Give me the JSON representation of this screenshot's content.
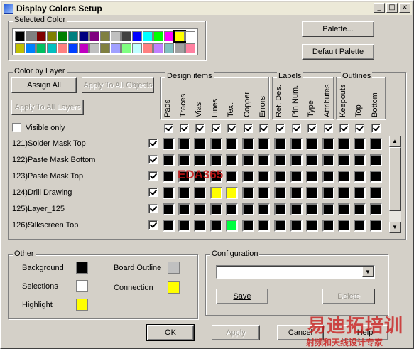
{
  "window": {
    "title": "Display Colors Setup"
  },
  "titlebar_buttons": {
    "minimize": "_",
    "maximize": "□",
    "close": "×"
  },
  "selected_color": {
    "label": "Selected Color",
    "row1": [
      "#000000",
      "#808080",
      "#800000",
      "#808000",
      "#008000",
      "#008080",
      "#000080",
      "#800080",
      "#808040",
      "#c0c0c0",
      "#404040",
      "#0000ff",
      "#00ffff",
      "#00ff00",
      "#ff00ff",
      "#ffff00",
      "#ffffff"
    ],
    "row2": [
      "#c0c000",
      "#0080ff",
      "#00c060",
      "#00c0c0",
      "#ff8080",
      "#0040ff",
      "#c000c0",
      "#c0c0c0",
      "#808040",
      "#a0a0ff",
      "#80ff80",
      "#c0ffff",
      "#ff8080",
      "#c080ff",
      "#80c0c0",
      "#a0a0a0",
      "#ff80a0"
    ],
    "selected_index": 15
  },
  "buttons": {
    "palette": "Palette...",
    "default_palette": "Default Palette",
    "assign_all": "Assign All",
    "apply_all_objects": "Apply To All Objects",
    "apply_all_layers": "Apply To All Layers",
    "save": "Save",
    "delete": "Delete",
    "ok": "OK",
    "apply": "Apply",
    "cancel": "Cancel",
    "help": "Help"
  },
  "color_by_layer": {
    "label": "Color by Layer",
    "visible_only": "Visible only",
    "groups": {
      "design": "Design items",
      "labels": "Labels",
      "outlines": "Outlines"
    },
    "columns": [
      "Pads",
      "Traces",
      "Vias",
      "Lines",
      "Text",
      "Copper",
      "Errors",
      "Ref. Des.",
      "Pin Num.",
      "Type",
      "Attributes",
      "Keepouts",
      "Top",
      "Bottom"
    ],
    "layers": [
      {
        "name": "121)Solder Mask Top",
        "colors": [
          "#000000",
          "#000000",
          "#000000",
          "#000000",
          "#000000",
          "#000000",
          "#000000",
          "#000000",
          "#000000",
          "#000000",
          "#000000",
          "#000000",
          "#000000",
          "#000000"
        ]
      },
      {
        "name": "122)Paste Mask Bottom",
        "colors": [
          "#000000",
          "#000000",
          "#000000",
          "#000000",
          "#000000",
          "#000000",
          "#000000",
          "#000000",
          "#000000",
          "#000000",
          "#000000",
          "#000000",
          "#000000",
          "#000000"
        ]
      },
      {
        "name": "123)Paste Mask Top",
        "colors": [
          "#000000",
          "#000000",
          "#000000",
          "#000000",
          "#000000",
          "#000000",
          "#000000",
          "#000000",
          "#000000",
          "#000000",
          "#000000",
          "#000000",
          "#000000",
          "#000000"
        ]
      },
      {
        "name": "124)Drill Drawing",
        "colors": [
          "#000000",
          "#000000",
          "#000000",
          "#ffff00",
          "#ffff00",
          "#000000",
          "#000000",
          "#000000",
          "#000000",
          "#000000",
          "#000000",
          "#000000",
          "#000000",
          "#000000"
        ]
      },
      {
        "name": "125)Layer_125",
        "colors": [
          "#000000",
          "#000000",
          "#000000",
          "#000000",
          "#000000",
          "#000000",
          "#000000",
          "#000000",
          "#000000",
          "#000000",
          "#000000",
          "#000000",
          "#000000",
          "#000000"
        ]
      },
      {
        "name": "126)Silkscreen Top",
        "colors": [
          "#000000",
          "#000000",
          "#000000",
          "#000000",
          "#00ff40",
          "#000000",
          "#000000",
          "#000000",
          "#000000",
          "#000000",
          "#000000",
          "#000000",
          "#000000",
          "#000000"
        ]
      }
    ]
  },
  "other": {
    "label": "Other",
    "background": {
      "label": "Background",
      "color": "#000000"
    },
    "selections": {
      "label": "Selections",
      "color": "#ffffff"
    },
    "highlight": {
      "label": "Highlight",
      "color": "#ffff00"
    },
    "board_outline": {
      "label": "Board Outline",
      "color": "#c0c0c0"
    },
    "connection": {
      "label": "Connection",
      "color": "#ffff00"
    }
  },
  "configuration": {
    "label": "Configuration",
    "value": ""
  },
  "watermarks": {
    "top": "EDA365",
    "bottom_main": "易迪拓培训",
    "bottom_sub": "射频和天线设计专家"
  }
}
